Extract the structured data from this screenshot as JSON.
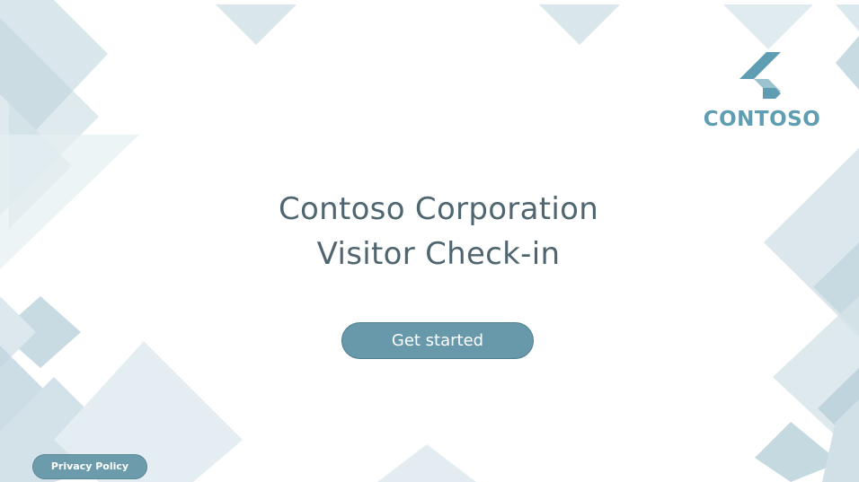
{
  "brand": {
    "logo_text": "CONTOSO",
    "logo_icon": "contoso-logo-icon",
    "logo_color": "#5e9db2"
  },
  "main": {
    "title_line1": "Contoso Corporation",
    "title_line2": "Visitor Check-in",
    "title_color": "#4f6671"
  },
  "actions": {
    "get_started_label": "Get started",
    "button_color": "#6899aa"
  },
  "footer": {
    "privacy_label": "Privacy Policy"
  }
}
